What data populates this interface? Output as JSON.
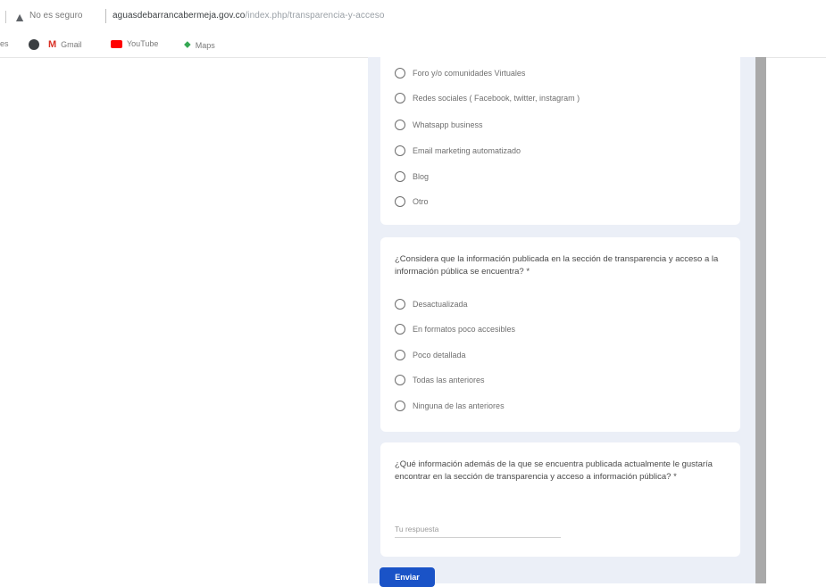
{
  "browser": {
    "security_label": "No es seguro",
    "url_domain": "aguasdebarrancabermeja.gov.co",
    "url_path": "/index.php/transparencia-y-acceso",
    "bookmarks_prefix": "es",
    "bookmarks": [
      {
        "label": "",
        "icon": "chrome-web-store-icon",
        "color": "#3c4043"
      },
      {
        "label": "Gmail",
        "icon": "gmail-icon",
        "color": "#d93025"
      },
      {
        "label": "YouTube",
        "icon": "youtube-icon",
        "color": "#ff0000"
      },
      {
        "label": "Maps",
        "icon": "maps-pin-icon",
        "color": "#34a853"
      }
    ]
  },
  "form": {
    "q1_options": [
      "Foro y/o comunidades Virtuales",
      "Redes sociales ( Facebook, twitter, instagram )",
      "Whatsapp business",
      "Email marketing automatizado",
      "Blog",
      "Otro"
    ],
    "q2": {
      "text": "¿Considera que la información publicada en la sección de transparencia y acceso a la información pública se encuentra? *",
      "options": [
        "Desactualizada",
        "En formatos poco accesibles",
        "Poco detallada",
        "Todas las anteriores",
        "Ninguna de las anteriores"
      ]
    },
    "q3": {
      "text": "¿Qué información además de la que se encuentra publicada actualmente le gustaría encontrar en la sección de transparencia y acceso a información pública? *",
      "placeholder": "Tu respuesta"
    },
    "submit_label": "Enviar"
  }
}
